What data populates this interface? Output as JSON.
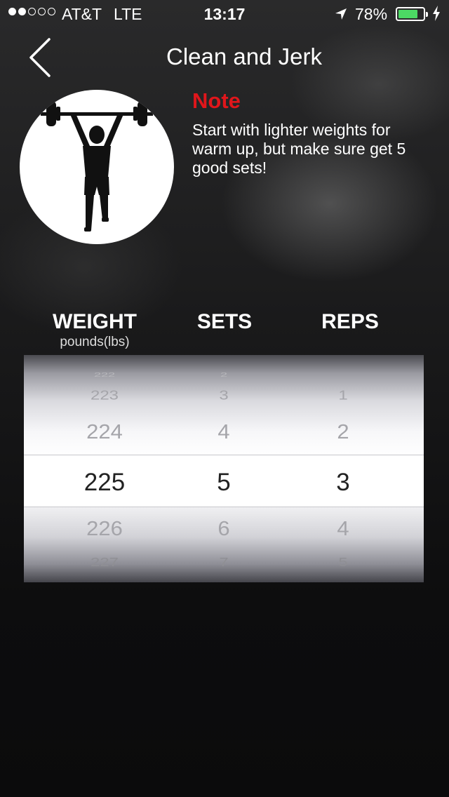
{
  "status_bar": {
    "carrier": "AT&T",
    "network": "LTE",
    "time": "13:17",
    "battery_percent": "78%",
    "battery_level": 0.78,
    "signal_bars_filled": 2,
    "signal_bars_total": 5
  },
  "nav": {
    "title": "Clean and Jerk",
    "back_icon": "chevron-left-icon"
  },
  "exercise": {
    "icon": "weightlifter-icon",
    "note_title": "Note",
    "note_text": "Start with lighter weights for warm up, but make sure get 5 good sets!"
  },
  "picker": {
    "weight_header": "WEIGHT",
    "weight_unit": "pounds(lbs)",
    "sets_header": "SETS",
    "reps_header": "REPS",
    "weight_values": [
      "222",
      "223",
      "224",
      "225",
      "226",
      "227"
    ],
    "sets_values": [
      "2",
      "3",
      "4",
      "5",
      "6",
      "7"
    ],
    "reps_values": [
      "",
      "1",
      "2",
      "3",
      "4",
      "5"
    ],
    "selected": {
      "weight": "225",
      "sets": "5",
      "reps": "3"
    }
  },
  "colors": {
    "accent_note": "#e0161b",
    "battery_green": "#4cd964"
  }
}
